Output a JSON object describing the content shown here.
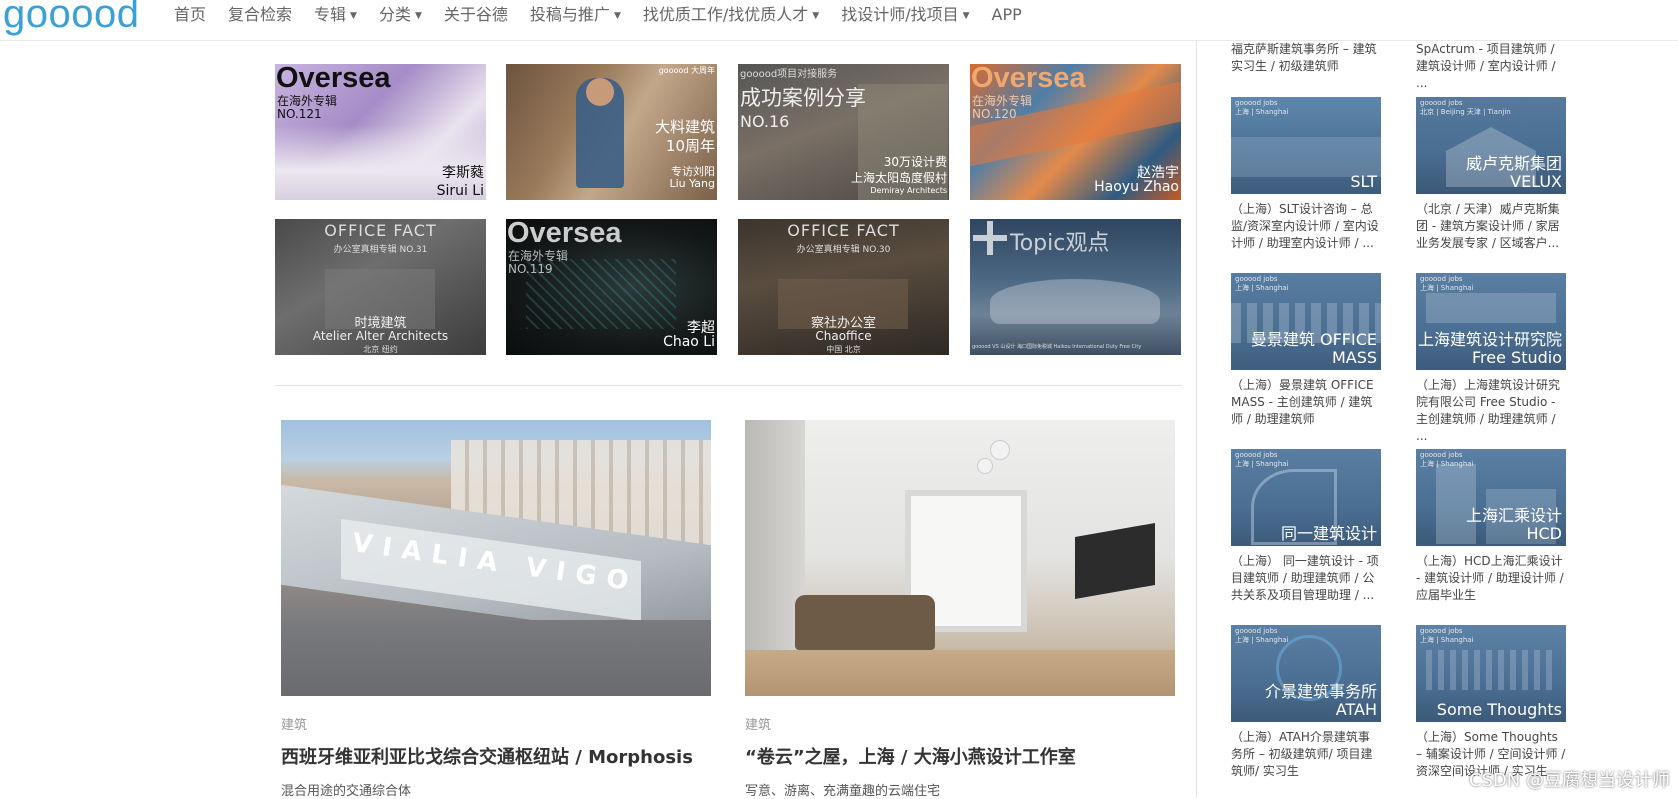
{
  "nav": {
    "logo": "gooood",
    "items": [
      {
        "label": "首页",
        "caret": false
      },
      {
        "label": "复合检索",
        "caret": false
      },
      {
        "label": "专辑",
        "caret": true
      },
      {
        "label": "分类",
        "caret": true
      },
      {
        "label": "关于谷德",
        "caret": false
      },
      {
        "label": "投稿与推广",
        "caret": true
      },
      {
        "label": "找优质工作/找优质人才",
        "caret": true
      },
      {
        "label": "找设计师/找项目",
        "caret": true
      },
      {
        "label": "APP",
        "caret": false
      }
    ]
  },
  "tiles": [
    {
      "big": "Oversea",
      "line1": "在海外专辑",
      "line2": "NO.121",
      "name_cn": "李斯蕤",
      "name_en": "Sirui Li"
    },
    {
      "small": "gooood 大周年",
      "line1": "大料建筑",
      "line2": "10周年",
      "name_cn": "专访刘阳",
      "name_en": "Liu Yang"
    },
    {
      "small": "gooood项目对接服务",
      "line1": "成功案例分享",
      "line2": "NO.16",
      "name_cn": "30万设计费",
      "name_en": "上海太阳岛度假村",
      "extra": "Demiray Architects"
    },
    {
      "big": "Oversea",
      "line1": "在海外专辑",
      "line2": "NO.120",
      "name_cn": "赵浩宇",
      "name_en": "Haoyu Zhao"
    },
    {
      "big": "OFFICE FACT",
      "line1": "办公室真相专辑 NO.31",
      "name_cn": "时境建筑",
      "name_en": "Atelier Alter Architects",
      "extra": "北京 纽约"
    },
    {
      "big": "Oversea",
      "line1": "在海外专辑",
      "line2": "NO.119",
      "name_cn": "李超",
      "name_en": "Chao Li"
    },
    {
      "big": "OFFICE FACT",
      "line1": "办公室真相专辑 NO.30",
      "name_cn": "察社办公室",
      "name_en": "Chaoffice",
      "extra": "中国 北京"
    },
    {
      "big": "Topic观点",
      "extra": "gooood VS 山设计 海口国际免税城 Haikou International Duty Free City"
    }
  ],
  "features": [
    {
      "category": "建筑",
      "title": "西班牙维亚利亚比戈综合交通枢纽站 / Morphosis",
      "subtitle": "混合用途的交通综合体",
      "sign": "VIALIA VIGO"
    },
    {
      "category": "建筑",
      "title": "“卷云”之屋，上海 / 大海小燕设计工作室",
      "subtitle": "写意、游离、充满童趣的云端住宅"
    }
  ],
  "jobs_top": [
    {
      "caption": "福克萨斯建筑事务所 – 建筑实习生 / 初级建筑师"
    },
    {
      "caption": "SpActrum - 项目建筑师 / 建筑设计师 / 室内设计师 / ..."
    }
  ],
  "jobs": [
    {
      "tag": "gooood jobs",
      "city": "上海 | Shanghai",
      "name": "SLT",
      "caption": "（上海）SLT设计咨询 – 总监/资深室内设计师 / 室内设计师 / 助理室内设计师 / ..."
    },
    {
      "tag": "gooood jobs",
      "city": "北京 | Beijing 天津 | Tianjin",
      "name": "威卢克斯集团 VELUX",
      "caption": "（北京 / 天津）威卢克斯集团 - 建筑方案设计师 / 家居业务发展专家 / 区域客户..."
    },
    {
      "tag": "gooood jobs",
      "city": "上海 | Shanghai",
      "name": "曼景建筑 OFFICE MASS",
      "caption": "（上海）曼景建筑 OFFICE MASS - 主创建筑师 / 建筑师 / 助理建筑师"
    },
    {
      "tag": "gooood jobs",
      "city": "上海 | Shanghai",
      "name": "上海建筑设计研究院 Free Studio",
      "caption": "（上海）上海建筑设计研究院有限公司 Free Studio - 主创建筑师 / 助理建筑师 / ..."
    },
    {
      "tag": "gooood jobs",
      "city": "上海 | Shanghai",
      "name": "同一建筑设计",
      "caption": "（上海） 同一建筑设计 - 项目建筑师 / 助理建筑师 / 公共关系及项目管理助理 / ..."
    },
    {
      "tag": "gooood jobs",
      "city": "上海 | Shanghai",
      "name": "上海汇乘设计 HCD",
      "caption": "（上海）HCD上海汇乘设计 - 建筑设计师 / 助理设计师 / 应届毕业生"
    },
    {
      "tag": "gooood jobs",
      "city": "上海 | Shanghai",
      "name": "介景建筑事务所 ATAH",
      "caption": "（上海）ATAH介景建筑事务所 – 初级建筑师/ 项目建筑师/ 实习生"
    },
    {
      "tag": "gooood jobs",
      "city": "上海 | Shanghai",
      "name": "Some Thoughts",
      "caption": "（上海）Some Thoughts – 辅案设计师 / 空间设计师 / 资深空间设计师 / 实习生"
    }
  ],
  "watermark": "CSDN @豆腐想当设计师",
  "colors": {
    "logo": "#3aa0d8",
    "nav_text": "#666666",
    "job_overlay": "#4a6f93"
  }
}
